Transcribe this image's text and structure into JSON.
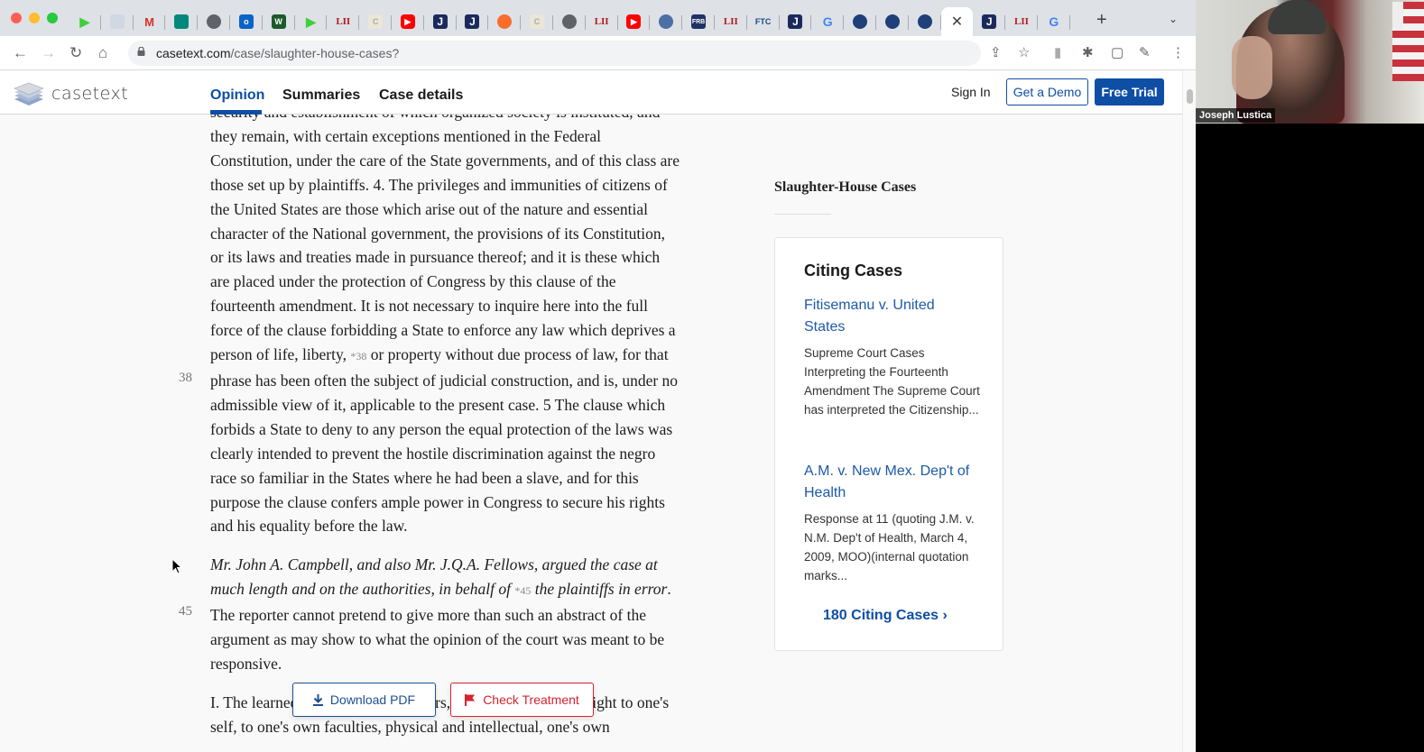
{
  "browser": {
    "tabs": [
      {
        "icon": "play-icon",
        "glyph": "▶",
        "cls": "play"
      },
      {
        "icon": "document-icon",
        "glyph": "",
        "cls": "doc"
      },
      {
        "icon": "gmail-icon",
        "glyph": "M",
        "cls": "gm"
      },
      {
        "icon": "meet-icon",
        "glyph": "",
        "cls": "meet"
      },
      {
        "icon": "globe-icon",
        "glyph": "",
        "cls": "gray"
      },
      {
        "icon": "outlook-icon",
        "glyph": "o",
        "cls": "ol"
      },
      {
        "icon": "w-icon",
        "glyph": "W",
        "cls": "w"
      },
      {
        "icon": "play-icon",
        "glyph": "▶",
        "cls": "play"
      },
      {
        "icon": "lii-icon",
        "glyph": "LII",
        "cls": "lii"
      },
      {
        "icon": "c-icon",
        "glyph": "C",
        "cls": "pale"
      },
      {
        "icon": "youtube-icon",
        "glyph": "▶",
        "cls": "yt"
      },
      {
        "icon": "j-icon",
        "glyph": "J",
        "cls": "j"
      },
      {
        "icon": "j-icon",
        "glyph": "J",
        "cls": "j"
      },
      {
        "icon": "soundcloud-icon",
        "glyph": "",
        "cls": "cloud"
      },
      {
        "icon": "c-icon",
        "glyph": "C",
        "cls": "pale"
      },
      {
        "icon": "chrome-icon",
        "glyph": "",
        "cls": "chrome"
      },
      {
        "icon": "lii-icon",
        "glyph": "LII",
        "cls": "lii"
      },
      {
        "icon": "youtube-icon",
        "glyph": "▶",
        "cls": "yt"
      },
      {
        "icon": "seal-icon",
        "glyph": "",
        "cls": "seal"
      },
      {
        "icon": "frb-icon",
        "glyph": "FRB",
        "cls": "frb"
      },
      {
        "icon": "lii-icon",
        "glyph": "LII",
        "cls": "lii"
      },
      {
        "icon": "ftc-icon",
        "glyph": "FTC",
        "cls": "ftc"
      },
      {
        "icon": "j-icon",
        "glyph": "J",
        "cls": "j"
      },
      {
        "icon": "google-icon",
        "glyph": "G",
        "cls": "g"
      },
      {
        "icon": "dhs-icon",
        "glyph": "",
        "cls": "dhs"
      },
      {
        "icon": "dhs-icon",
        "glyph": "",
        "cls": "dhs"
      },
      {
        "icon": "dhs-icon",
        "glyph": "",
        "cls": "dhs"
      },
      {
        "icon": "close-icon",
        "glyph": "✕",
        "cls": "active"
      },
      {
        "icon": "j-icon",
        "glyph": "J",
        "cls": "j"
      },
      {
        "icon": "lii-icon",
        "glyph": "LII",
        "cls": "lii"
      },
      {
        "icon": "google-icon",
        "glyph": "G",
        "cls": "g"
      }
    ],
    "url_domain": "casetext.com",
    "url_path": "/case/slaughter-house-cases?"
  },
  "site": {
    "logo_text": "casetext",
    "nav": {
      "opinion": "Opinion",
      "summaries": "Summaries",
      "case_details": "Case details"
    },
    "sign_in": "Sign In",
    "get_demo": "Get a Demo",
    "free_trial": "Free Trial"
  },
  "opinion": {
    "p1_a": "security and establishment of which organized society is instituted, and they remain, with certain exceptions mentioned in the Federal Constitution, under the care of the State governments, and of this class are those set up by plaintiffs. 4. The privileges and immunities of citizens of the United States are those which arise out of the nature and essential character of the National government, the provisions of its Constitution, or its laws and treaties made in pursuance thereof; and it is these which are placed under the protection of Congress by this clause of the fourteenth amendment. It is not necessary to inquire here into the full force of the clause forbidding a State to enforce any law which deprives a person of life, liberty,",
    "p1_pin": "*38",
    "p1_b": "or property without due process of law, for that phrase has been often the subject of judicial construction, and is, under no admissible view of it, applicable to the present case. 5 The clause which forbids a State to deny to any person the equal protection of the laws was clearly intended to prevent the hostile discrimination against the negro race so familiar in the States where he had been a slave, and for this purpose the clause confers ample power in Congress to secure his rights and his equality before the law.",
    "p2_a": "Mr. John A. Campbell, and also Mr. J.Q.A. Fellows, argued the case at much length and on the authorities, in behalf of",
    "p2_pin": "*45",
    "p2_b": "the plaintiffs in error",
    "p2_c": ". The reporter cannot pretend to give more than such an abstract of the argument as may show to what the opinion of the court was meant to be responsive.",
    "p3": "I. The learned counsel quoting Thiers, \"contended that \"the right to one's self, to one's own faculties, physical and intellectual, one's own",
    "page_num_38": "38",
    "page_num_45": "45"
  },
  "sidebar": {
    "case_title": "Slaughter-House Cases",
    "citing_heading": "Citing Cases",
    "citing": [
      {
        "title": "Fitisemanu v. United States",
        "snippet": "Supreme Court Cases Interpreting the Fourteenth Amendment The Supreme Court has interpreted the Citizenship..."
      },
      {
        "title": "A.M. v. New Mex. Dep't of Health",
        "snippet": "Response at 11 (quoting J.M. v. N.M. Dep't of Health, March 4, 2009, MOO)(internal quotation marks..."
      }
    ],
    "more_citing": "180 Citing Cases"
  },
  "actions": {
    "download_pdf": "Download PDF",
    "check_treatment": "Check Treatment"
  },
  "video": {
    "participant_name": "Joseph Lustica"
  },
  "colors": {
    "brand_blue": "#0f4ea5",
    "link_blue": "#1d5aa7",
    "treatment_red": "#d6232f"
  }
}
